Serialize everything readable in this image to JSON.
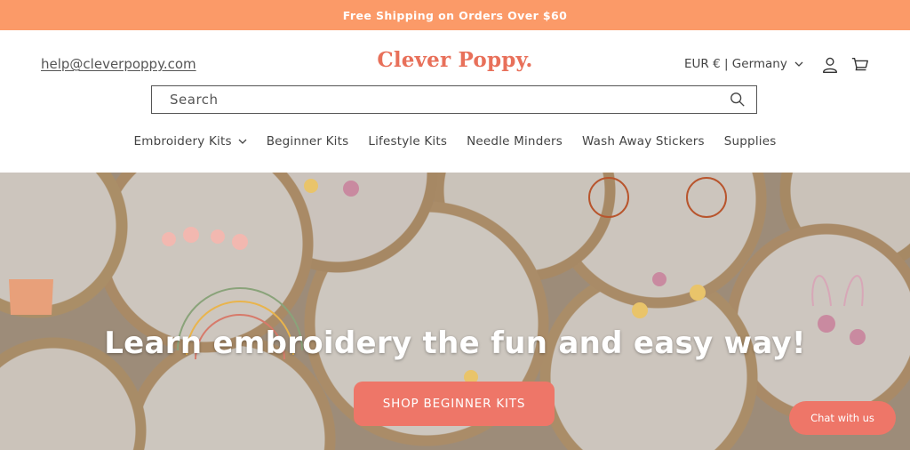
{
  "announcement": "Free Shipping on Orders Over $60",
  "header": {
    "email": "help@cleverpoppy.com",
    "logo_text": "Clever Poppy.",
    "locale": "EUR € | Germany",
    "account_icon": "user-icon",
    "cart_icon": "cart-icon"
  },
  "search": {
    "placeholder": "Search",
    "icon": "search-icon"
  },
  "nav": {
    "items": [
      {
        "label": "Embroidery Kits"
      },
      {
        "label": "Beginner Kits"
      },
      {
        "label": "Lifestyle Kits"
      },
      {
        "label": "Needle Minders"
      },
      {
        "label": "Wash Away Stickers"
      },
      {
        "label": "Supplies"
      }
    ]
  },
  "hero": {
    "title": "Learn embroidery the fun and easy way!",
    "cta": "SHOP BEGINNER KITS"
  },
  "chat": {
    "label": "Chat with us"
  },
  "colors": {
    "announcement_bg": "#fb9a68",
    "brand": "#e8705a",
    "cta_bg": "#ee7668"
  }
}
